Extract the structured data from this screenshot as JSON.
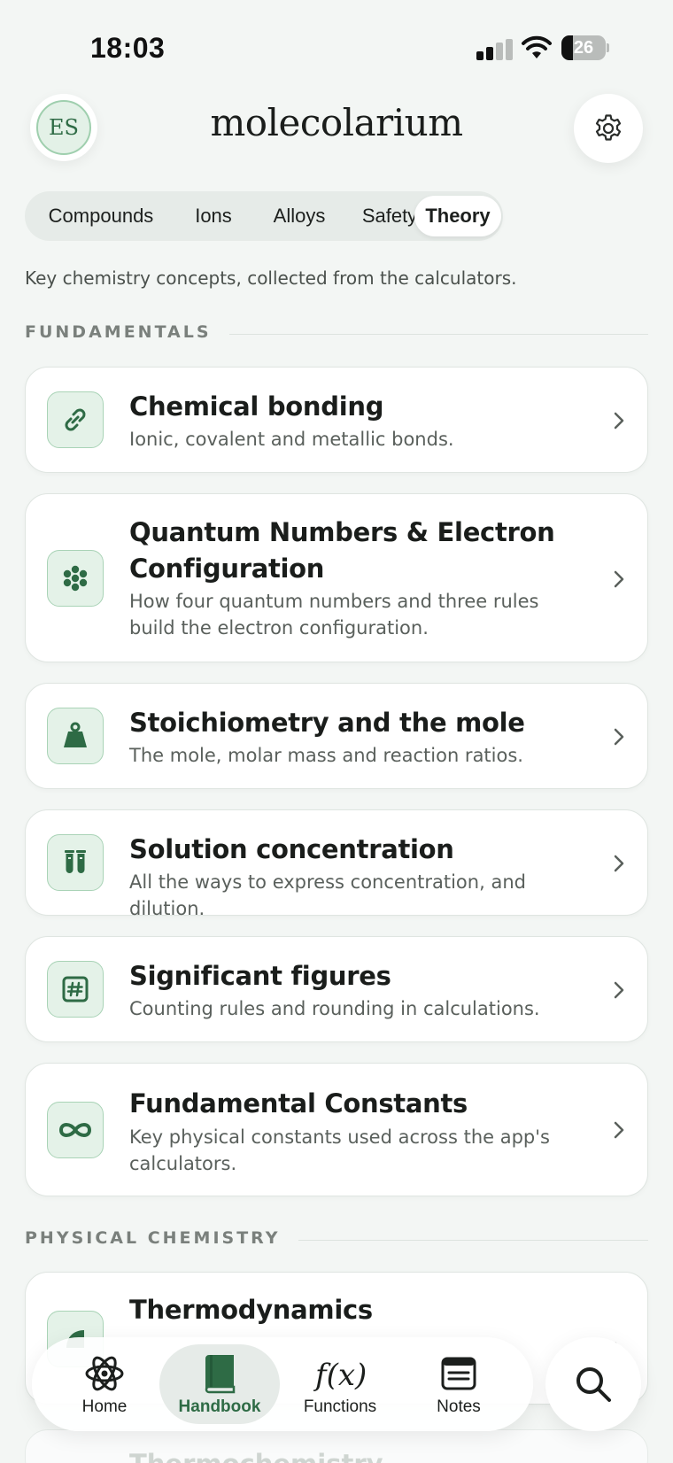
{
  "status_bar": {
    "time": "18:03",
    "battery_level": "26"
  },
  "header": {
    "avatar_initials": "ES",
    "app_title": "molecolarium"
  },
  "tabs": [
    {
      "label": "Compounds",
      "active": false
    },
    {
      "label": "Ions",
      "active": false
    },
    {
      "label": "Alloys",
      "active": false
    },
    {
      "label": "Safety",
      "active": false
    },
    {
      "label": "Theory",
      "active": true
    }
  ],
  "intro": "Key chemistry concepts, collected from the calculators.",
  "sections": [
    {
      "label": "FUNDAMENTALS",
      "items": [
        {
          "title": "Chemical bonding",
          "subtitle": "Ionic, covalent and metallic bonds.",
          "icon": "link-icon"
        },
        {
          "title": "Quantum Numbers & Electron Configuration",
          "subtitle": "How four quantum numbers and three rules build the electron configuration.",
          "icon": "orbital-dots-icon"
        },
        {
          "title": "Stoichiometry and the mole",
          "subtitle": "The mole, molar mass and reaction ratios.",
          "icon": "weight-icon"
        },
        {
          "title": "Solution concentration",
          "subtitle": "All the ways to express concentration, and dilution.",
          "icon": "test-tubes-icon"
        },
        {
          "title": "Significant figures",
          "subtitle": "Counting rules and rounding in calculations.",
          "icon": "number-sign-icon"
        },
        {
          "title": "Fundamental Constants",
          "subtitle": "Key physical constants used across the app's calculators.",
          "icon": "infinity-icon"
        }
      ]
    },
    {
      "label": "PHYSICAL CHEMISTRY",
      "items": [
        {
          "title": "Thermodynamics",
          "subtitle": "",
          "icon": "thermo-icon"
        },
        {
          "title": "Thermochemistry",
          "subtitle": "",
          "icon": ""
        }
      ]
    }
  ],
  "bottom_nav": [
    {
      "label": "Home",
      "icon": "atom-icon",
      "active": false
    },
    {
      "label": "Handbook",
      "icon": "book-icon",
      "active": true
    },
    {
      "label": "Functions",
      "icon": "function-icon",
      "active": false
    },
    {
      "label": "Notes",
      "icon": "notes-icon",
      "active": false
    }
  ],
  "colors": {
    "accent": "#2e6b45",
    "icon_bg": "#e4f2e8",
    "background": "#f3f6f4"
  }
}
